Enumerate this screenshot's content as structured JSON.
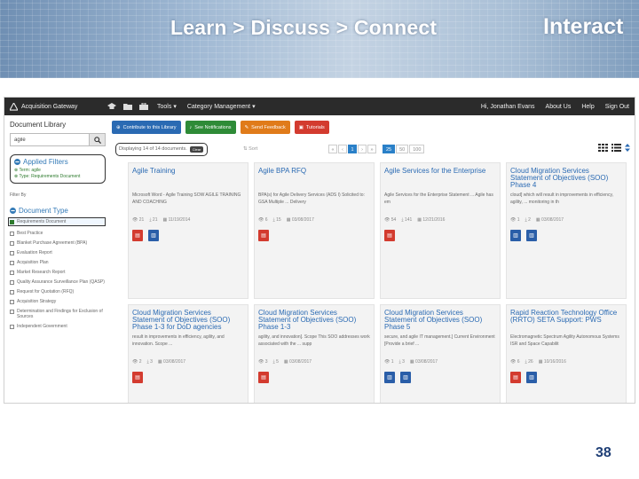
{
  "banner": {
    "tagline": "Learn > Discuss > Connect",
    "interact": "Interact"
  },
  "navbar": {
    "brand": "Acquisition Gateway",
    "tools": "Tools",
    "category": "Category Management",
    "user": "Hi, Jonathan Evans",
    "about": "About Us",
    "help": "Help",
    "signout": "Sign Out"
  },
  "sidebar": {
    "title": "Document Library",
    "search_value": "agile",
    "applied_header": "Applied Filters",
    "applied": [
      "Term: agile",
      "Type: Requirements Document"
    ],
    "filter_by": "Filter By",
    "doctype_header": "Document Type",
    "options": [
      {
        "label": "Requirements Document",
        "selected": true
      },
      {
        "label": "Best Practice",
        "selected": false
      },
      {
        "label": "Blanket Purchase Agreement (BPA)",
        "selected": false
      },
      {
        "label": "Evaluation Report",
        "selected": false
      },
      {
        "label": "Acquisition Plan",
        "selected": false
      },
      {
        "label": "Market Research Report",
        "selected": false
      },
      {
        "label": "Quality Assurance Surveillance Plan (QASP)",
        "selected": false
      },
      {
        "label": "Request for Quotation (RFQ)",
        "selected": false
      },
      {
        "label": "Acquisition Strategy",
        "selected": false
      },
      {
        "label": "Determination and Findings for Exclusion of Sources",
        "selected": false
      },
      {
        "label": "Independent Government",
        "selected": false
      }
    ]
  },
  "actions": {
    "contribute": "Contribute to this Library",
    "notifications": "See Notifications",
    "feedback": "Send Feedback",
    "tutorials": "Tutorials"
  },
  "controls": {
    "displaying": "Displaying 14 of 14 documents.",
    "clear": "Clear",
    "sort": "Sort",
    "pages": [
      "«",
      "‹",
      "1",
      "›",
      "»"
    ],
    "active_page": "1",
    "sizes": [
      "25",
      "50",
      "100"
    ],
    "active_size": "25"
  },
  "cards": [
    {
      "title": "Agile Training",
      "snippet": "Microsoft Word - Agile Training SOW AGILE TRAINING AND COACHING",
      "views": "21",
      "downloads": "21",
      "date": "11/19/2014",
      "files": [
        "pdf",
        "doc"
      ]
    },
    {
      "title": "Agile BPA RFQ",
      "snippet": "BPA(s) for Agile Delivery Services (ADS I) Solicited to: GSA Multiple ... Delivery",
      "views": "6",
      "downloads": "15",
      "date": "03/08/2017",
      "files": [
        "pdf"
      ]
    },
    {
      "title": "Agile Services for the Enterprise",
      "snippet": "Agile Services for the Enterprise Statement ... Agile has em",
      "views": "54",
      "downloads": "141",
      "date": "12/21/2016",
      "files": [
        "pdf"
      ]
    },
    {
      "title": "Cloud Migration Services Statement of Objectives (SOO) Phase 4",
      "snippet": "cloud] which will result in improvements in efficiency, agility, ... monitoring in th",
      "views": "1",
      "downloads": "2",
      "date": "03/08/2017",
      "files": [
        "doc",
        "doc"
      ]
    },
    {
      "title": "Cloud Migration Services Statement of Objectives (SOO) Phase 1-3 for DoD agencies",
      "snippet": "result in improvements in efficiency, agility, and innovation. Scope ...",
      "views": "2",
      "downloads": "3",
      "date": "03/08/2017",
      "files": [
        "pdf"
      ]
    },
    {
      "title": "Cloud Migration Services Statement of Objectives (SOO) Phase 1-3",
      "snippet": "agility, and innovation]. Scope This SOO addresses work associated with the ... supp",
      "views": "3",
      "downloads": "5",
      "date": "03/08/2017",
      "files": [
        "pdf"
      ]
    },
    {
      "title": "Cloud Migration Services Statement of Objectives (SOO) Phase 5",
      "snippet": "secure, and agile IT management.] Current Environment [Provide a brief ...",
      "views": "1",
      "downloads": "3",
      "date": "03/08/2017",
      "files": [
        "doc",
        "doc"
      ]
    },
    {
      "title": "Rapid Reaction Technology Office (RRTO) SETA Support: PWS",
      "snippet": "Electromagnetic Spectrum Agility Autonomous Systems ISR and Space Capabilit",
      "views": "6",
      "downloads": "26",
      "date": "10/16/2016",
      "files": [
        "pdf",
        "doc"
      ]
    }
  ],
  "slide_number": "38"
}
